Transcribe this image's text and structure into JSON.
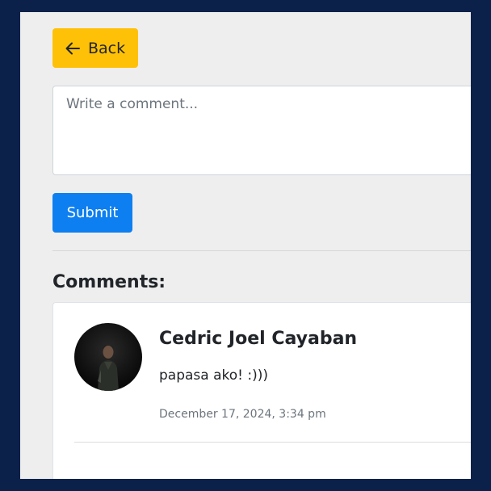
{
  "back_button": {
    "label": "Back",
    "icon": "arrow-left-icon"
  },
  "comment_input": {
    "placeholder": "Write a comment...",
    "value": ""
  },
  "submit_button": {
    "label": "Submit"
  },
  "comments_section": {
    "heading": "Comments:",
    "comments": [
      {
        "author": "Cedric Joel Cayaban",
        "text": "papasa ako! :)))",
        "timestamp": "December 17, 2024, 3:34 pm"
      }
    ]
  },
  "colors": {
    "page_background": "#0b2149",
    "panel_background": "#eeeeee",
    "back_button": "#ffc107",
    "submit_button": "#0d7ff0"
  }
}
